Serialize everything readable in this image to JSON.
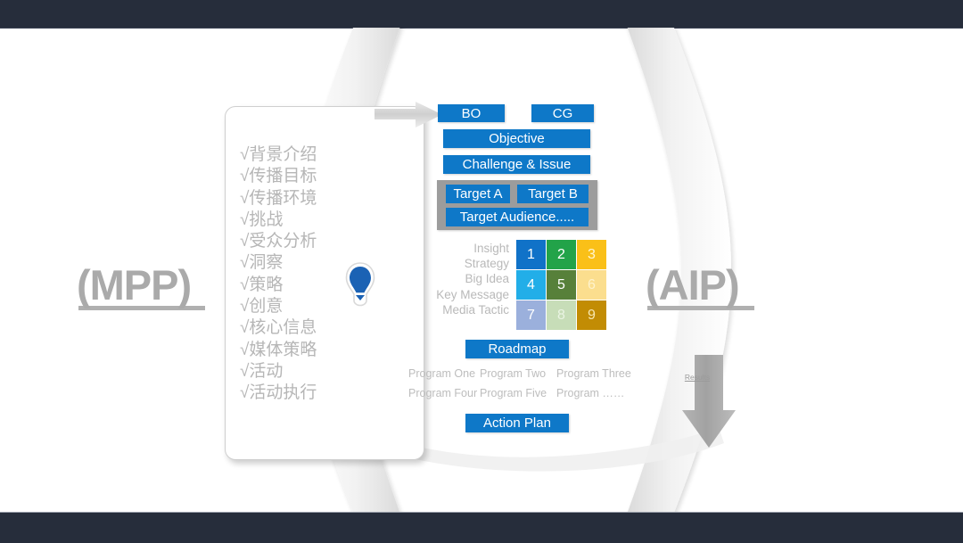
{
  "slide": {
    "background_color": "#ffffff",
    "chrome_color": "#262D3B"
  },
  "left_label": {
    "text": "(MPP)",
    "color": "#aaaaaa"
  },
  "right_label": {
    "text": "(AIP)",
    "color": "#aaaaaa"
  },
  "checklist": {
    "items": [
      "√背景介绍",
      "√传播目标",
      "√传播环境",
      "√挑战",
      "√受众分析",
      "√洞察",
      "√策略",
      "√创意",
      "√核心信息",
      "√媒体策略",
      "√活动",
      "√活动执行"
    ]
  },
  "flow": {
    "accent_color": "#0E78C8",
    "top_boxes": [
      {
        "label": "BO"
      },
      {
        "label": "CG"
      }
    ],
    "objective": "Objective",
    "challenge": "Challenge & Issue",
    "target_group": {
      "container_color": "#9c9c9c",
      "target_a": "Target A",
      "target_b": "Target B",
      "target_audience": "Target Audience....."
    },
    "roadmap": "Roadmap",
    "action_plan": "Action Plan"
  },
  "matrix": {
    "row_labels": [
      "Insight",
      "Strategy",
      "Big Idea",
      "Key Message",
      "Media Tactic"
    ],
    "cells": [
      {
        "value": "1",
        "color": "#1072C8",
        "text_color": "#ffffff"
      },
      {
        "value": "2",
        "color": "#22A349",
        "text_color": "#ffffff"
      },
      {
        "value": "3",
        "color": "#FAC018",
        "text_color": "#fff6d2"
      },
      {
        "value": "4",
        "color": "#22AEE8",
        "text_color": "#ffffff"
      },
      {
        "value": "5",
        "color": "#57803A",
        "text_color": "#ffffff"
      },
      {
        "value": "6",
        "color": "#FBDE8E",
        "text_color": "#fef3cd"
      },
      {
        "value": "7",
        "color": "#9BB0DC",
        "text_color": "#ffffff"
      },
      {
        "value": "8",
        "color": "#C7DDB8",
        "text_color": "#eaf4e3"
      },
      {
        "value": "9",
        "color": "#C28C04",
        "text_color": "#f7e7b0"
      }
    ]
  },
  "programs": {
    "row_one": [
      "Program One",
      "Program Two",
      "Program Three"
    ],
    "row_two": [
      "Program Four",
      "Program Five",
      "Program ……"
    ]
  },
  "results": {
    "label": "Results",
    "arrow_color": "#a6a6a6"
  }
}
